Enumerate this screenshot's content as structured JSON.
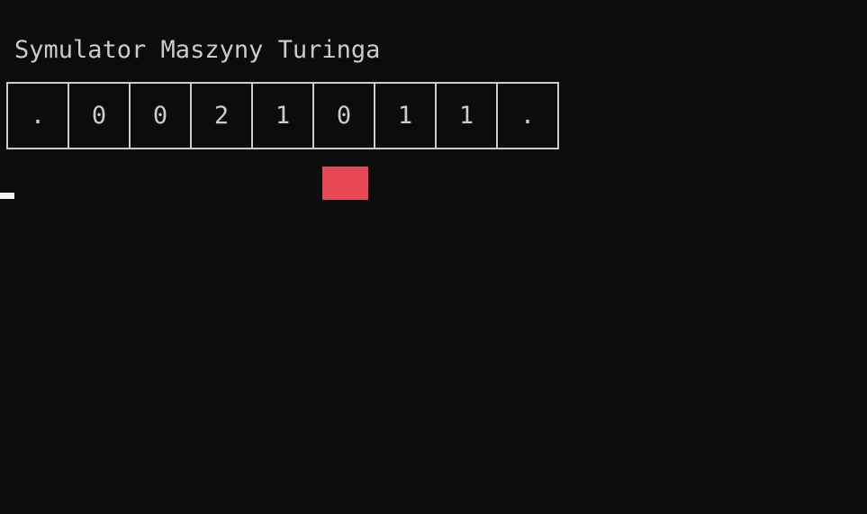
{
  "title": "Symulator Maszyny Turinga",
  "tape": {
    "cells": [
      ".",
      "0",
      "0",
      "2",
      "1",
      "0",
      "1",
      "1",
      "."
    ],
    "head_index": 5
  },
  "colors": {
    "background": "#0c0c0c",
    "text": "#cccccc",
    "head": "#e74856",
    "cursor": "#f2f2f2"
  }
}
